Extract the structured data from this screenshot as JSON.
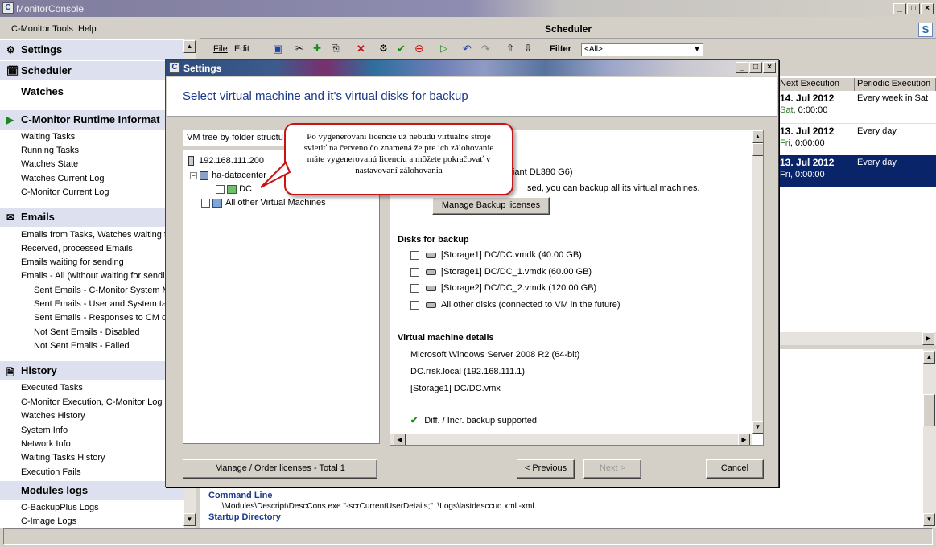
{
  "app": {
    "title": "MonitorConsole",
    "menu": [
      "C-Monitor Tools",
      "Help"
    ]
  },
  "nav": {
    "settings": "Settings",
    "scheduler": "Scheduler",
    "watches": "Watches",
    "runtime": "C-Monitor Runtime Informat",
    "runtime_items": [
      "Waiting Tasks",
      "Running Tasks",
      "Watches State",
      "Watches Current Log",
      "C-Monitor Current Log"
    ],
    "emails": "Emails",
    "email_items": [
      "Emails from Tasks, Watches waiting for",
      "Received, processed Emails",
      "Emails waiting for sending",
      "Emails - All (without waiting for sending)"
    ],
    "email_sub_items": [
      "Sent Emails - C-Monitor System Mes",
      "Sent Emails - User and System task",
      "Sent Emails - Responses to CM que",
      "Not Sent Emails - Disabled",
      "Not Sent Emails - Failed"
    ],
    "history": "History",
    "history_items": [
      "Executed Tasks",
      "C-Monitor Execution, C-Monitor Log His",
      "Watches History",
      "System Info",
      "Network Info",
      "Waiting Tasks History",
      "Execution Fails"
    ],
    "modules": "Modules logs",
    "modules_items": [
      "C-BackupPlus Logs",
      "C-Image Logs"
    ]
  },
  "scheduler": {
    "title": "Scheduler",
    "toolbar": {
      "file": "File",
      "edit": "Edit",
      "filter_label": "Filter",
      "filter_value": "<All>"
    },
    "columns": [
      "Next Execution",
      "Periodic Execution"
    ],
    "rows": [
      {
        "date": "14. Jul 2012",
        "weekday": "Sat",
        "time": "0:00:00",
        "periodic": "Every week in Sat"
      },
      {
        "date": "13. Jul 2012",
        "weekday": "Fri",
        "time": "0:00:00",
        "periodic": "Every day"
      },
      {
        "date": "13. Jul 2012",
        "weekday": "Fri",
        "time": "0:00:00",
        "periodic": "Every day"
      }
    ],
    "lower": {
      "command_line_label": "Command Line",
      "command_line": ".\\Modules\\Descript\\DescCons.exe \"-scrCurrentUserDetails;\" .\\Logs\\lastdesccud.xml -xml",
      "startup_label": "Startup Directory"
    }
  },
  "dialog": {
    "title": "Settings",
    "heading": "Select virtual machine and it's virtual disks for backup",
    "tree_combo": "VM tree by folder structu",
    "tree": {
      "host": "192.168.111.200",
      "datacenter": "ha-datacenter",
      "vm": "DC",
      "other": "All other Virtual Machines"
    },
    "server_model_fragment": "roLiant DL380 G6)",
    "license_fragment": "sed, you can backup all its virtual machines.",
    "manage_backup_licenses": "Manage Backup licenses",
    "disks_heading": "Disks for backup",
    "disks": [
      "[Storage1] DC/DC.vmdk (40.00 GB)",
      "[Storage1] DC/DC_1.vmdk (60.00 GB)",
      "[Storage2] DC/DC_2.vmdk (120.00 GB)",
      "All other disks (connected to VM in the future)"
    ],
    "details_heading": "Virtual machine details",
    "details": [
      "Microsoft Windows Server 2008 R2 (64-bit)",
      "DC.rrsk.local (192.168.111.1)",
      "[Storage1] DC/DC.vmx"
    ],
    "diff_supported": "Diff. / Incr. backup supported",
    "buttons": {
      "manage_order": "Manage / Order licenses - Total 1",
      "previous": "< Previous",
      "next": "Next >",
      "cancel": "Cancel"
    },
    "callout": "Po vygenerovaní licencie už nebudú virtuálne stroje svietiť na červeno čo znamená že pre ich zálohovanie máte vygenerovanú licenciu a môžete pokračovať v nastavovaní zálohovania"
  },
  "colors": {
    "accent_blue": "#1a3a8a",
    "nav_section_bg": "#dde0ee",
    "selected_row": "#0a246a",
    "callout_border": "#c81414",
    "weekday_green": "#2a7a2a"
  }
}
